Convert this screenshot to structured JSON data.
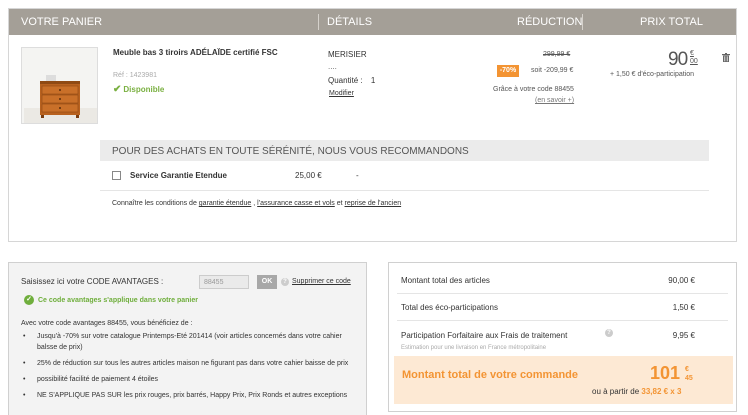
{
  "cart": {
    "headers": {
      "panier": "VOTRE PANIER",
      "details": "DÉTAILS",
      "reduction": "RÉDUCTION",
      "prix_total": "PRIX TOTAL"
    },
    "item": {
      "name": "Meuble bas 3 tiroirs ADÉLAÏDE certifié FSC",
      "ref": "Réf : 1423981",
      "availability": "Disponible",
      "detail_color": "MERISIER",
      "detail_dots": "....",
      "quantity_label": "Quantité :",
      "quantity": "1",
      "modify_label": "Modifier",
      "old_price": "299,99 €",
      "discount_badge": "-70%",
      "saving": "soit -209,99 €",
      "code_note": "Grâce à votre code 88455",
      "learn_more": "(en savoir +)",
      "price_int": "90",
      "price_cur": "€",
      "price_cents": "00",
      "eco_fee": "+ 1,50 € d'éco-participation"
    },
    "reco_title": "POUR DES ACHATS EN TOUTE SÉRÉNITÉ, NOUS VOUS RECOMMANDONS",
    "service": {
      "name": "Service Garantie Etendue",
      "price": "25,00 €",
      "extra": "-"
    },
    "conditions": {
      "prefix": "Connaître les conditions de ",
      "link1": "garantie étendue",
      "sep1": " , ",
      "link2": "l'assurance casse et vols",
      "sep2": " et ",
      "link3": "reprise de l'ancien"
    }
  },
  "promo": {
    "label": "Saisissez ici votre CODE AVANTAGES :",
    "code_value": "88455",
    "ok_label": "OK",
    "remove_label": "Supprimer ce code",
    "success": "Ce code avantages s'applique dans votre panier",
    "intro": "Avec votre code avantages 88455, vous bénéficiez de :",
    "benefits": [
      "Jusqu'à -70% sur votre catalogue Printemps-Eté 201414 (voir articles concernés dans votre cahier balsse de prix)",
      "25% de réduction sur tous les autres articles maison ne figurant pas dans votre cahier baisse de prix",
      "possibilité facilité de paiement 4 étoiles",
      "NE S'APPLIQUE PAS SUR les prix rouges, prix barrés, Happy Prix, Prix Ronds et autres exceptions"
    ]
  },
  "summary": {
    "rows": [
      {
        "label": "Montant total des articles",
        "value": "90,00 €"
      },
      {
        "label": "Total des éco-participations",
        "value": "1,50 €"
      },
      {
        "label": "Participation Forfaitaire aux Frais de traitement",
        "value": "9,95 €"
      }
    ],
    "sub_note": "Estimation pour une livraison en France métropolitaine",
    "total_label": "Montant total de votre commande",
    "total_int": "101",
    "total_cur": "€",
    "total_cents": "45",
    "installments_prefix": "ou à partir de ",
    "installments_value": "33,82 € x 3"
  },
  "colors": {
    "header": "#a49f97",
    "accent": "#f39433",
    "success": "#6fae3c",
    "total_bg": "#fde9d4"
  }
}
